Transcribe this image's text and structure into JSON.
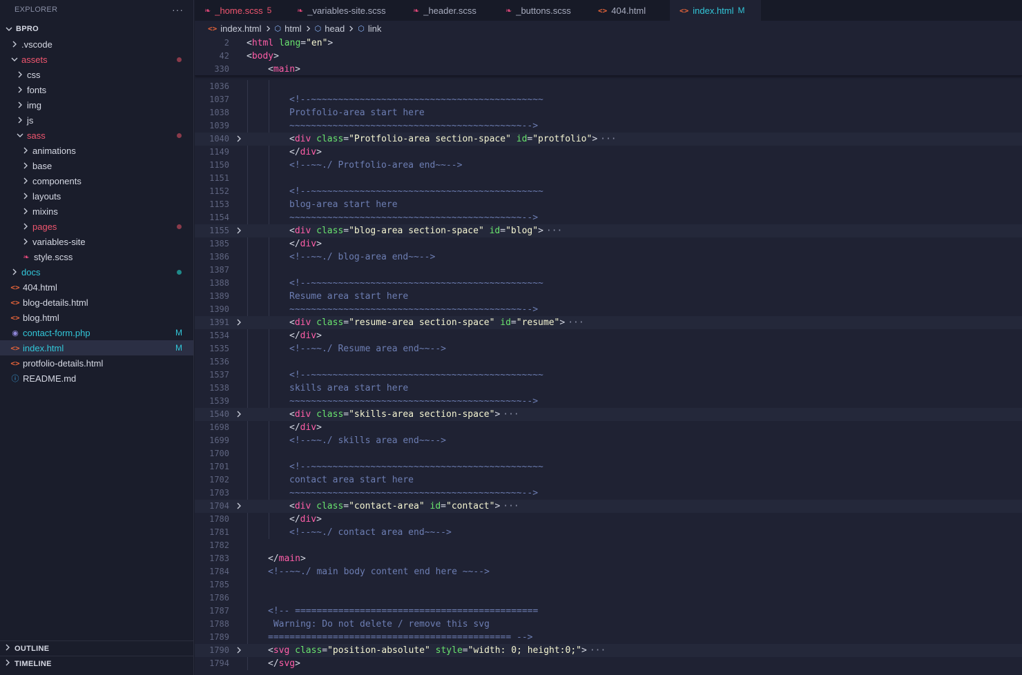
{
  "sidebar": {
    "title": "EXPLORER",
    "menu": "···",
    "tree": [
      {
        "label": "BPRO",
        "kind": "root",
        "chev": "down"
      },
      {
        "label": ".vscode",
        "kind": "folder",
        "chev": "right"
      },
      {
        "label": "assets",
        "kind": "folder",
        "chev": "down",
        "status": "err",
        "dot": "red"
      },
      {
        "label": "css",
        "kind": "folder",
        "chev": "right"
      },
      {
        "label": "fonts",
        "kind": "folder",
        "chev": "right"
      },
      {
        "label": "img",
        "kind": "folder",
        "chev": "right"
      },
      {
        "label": "js",
        "kind": "folder",
        "chev": "right"
      },
      {
        "label": "sass",
        "kind": "folder",
        "chev": "down",
        "status": "err",
        "dot": "red"
      },
      {
        "label": "animations",
        "kind": "folder",
        "chev": "right"
      },
      {
        "label": "base",
        "kind": "folder",
        "chev": "right"
      },
      {
        "label": "components",
        "kind": "folder",
        "chev": "right"
      },
      {
        "label": "layouts",
        "kind": "folder",
        "chev": "right"
      },
      {
        "label": "mixins",
        "kind": "folder",
        "chev": "right"
      },
      {
        "label": "pages",
        "kind": "folder",
        "chev": "right",
        "status": "err",
        "dot": "red"
      },
      {
        "label": "variables-site",
        "kind": "folder",
        "chev": "right"
      },
      {
        "label": "style.scss",
        "kind": "file",
        "icon": "sass-icon"
      },
      {
        "label": "docs",
        "kind": "folder",
        "chev": "right",
        "status": "cyan",
        "dot": "teal"
      },
      {
        "label": "404.html",
        "kind": "file",
        "icon": "html-icon"
      },
      {
        "label": "blog-details.html",
        "kind": "file",
        "icon": "html-icon"
      },
      {
        "label": "blog.html",
        "kind": "file",
        "icon": "html-icon"
      },
      {
        "label": "contact-form.php",
        "kind": "file",
        "icon": "php-icon",
        "status": "cyan",
        "badge": "M"
      },
      {
        "label": "index.html",
        "kind": "file",
        "icon": "html-icon",
        "status": "cyan",
        "badge": "M",
        "active": true
      },
      {
        "label": "protfolio-details.html",
        "kind": "file",
        "icon": "html-icon"
      },
      {
        "label": "README.md",
        "kind": "file",
        "icon": "info-icon"
      }
    ],
    "outline": "OUTLINE",
    "timeline": "TIMELINE"
  },
  "tabs": [
    {
      "label": "_home.scss",
      "icon": "sass-icon",
      "err": true,
      "count": "5"
    },
    {
      "label": "_variables-site.scss",
      "icon": "sass-icon"
    },
    {
      "label": "_header.scss",
      "icon": "sass-icon"
    },
    {
      "label": "_buttons.scss",
      "icon": "sass-icon"
    },
    {
      "label": "404.html",
      "icon": "html-icon"
    },
    {
      "label": "index.html",
      "icon": "html-icon",
      "active": true,
      "modified": "M"
    }
  ],
  "breadcrumb": [
    "index.html",
    "html",
    "head",
    "link"
  ],
  "colors": {
    "tag": "#ff5ea8",
    "attr": "#69e36e",
    "string": "#f5f5d2",
    "comment": "#6d7eb3",
    "accent": "#32c7d9",
    "error": "#f0566f"
  },
  "sticky_lines": [
    {
      "n": "2",
      "tokens": [
        [
          "b",
          "<"
        ],
        [
          "tag",
          "html"
        ],
        [
          "attr",
          " lang"
        ],
        [
          "b",
          "="
        ],
        [
          "str",
          "\"en\""
        ],
        [
          "b",
          ">"
        ]
      ],
      "indent": 0
    },
    {
      "n": "42",
      "tokens": [
        [
          "b",
          "<"
        ],
        [
          "tag",
          "body"
        ],
        [
          "b",
          ">"
        ]
      ],
      "indent": 0
    },
    {
      "n": "330",
      "tokens": [
        [
          "b",
          "<"
        ],
        [
          "tag",
          "main"
        ],
        [
          "b",
          ">"
        ]
      ],
      "indent": 1
    }
  ],
  "lines": [
    {
      "n": "1036",
      "indent": 2,
      "tokens": []
    },
    {
      "n": "1037",
      "indent": 2,
      "tokens": [
        [
          "com",
          "<!--~~~~~~~~~~~~~~~~~~~~~~~~~~~~~~~~~~~~~~~~~~~"
        ]
      ]
    },
    {
      "n": "1038",
      "indent": 2,
      "tokens": [
        [
          "com",
          "Protfolio-area start here"
        ]
      ]
    },
    {
      "n": "1039",
      "indent": 2,
      "tokens": [
        [
          "com",
          "~~~~~~~~~~~~~~~~~~~~~~~~~~~~~~~~~~~~~~~~~~~-->"
        ]
      ]
    },
    {
      "n": "1040",
      "indent": 2,
      "fold": true,
      "tokens": [
        [
          "b",
          "<"
        ],
        [
          "tag",
          "div"
        ],
        [
          "attr",
          " class"
        ],
        [
          "b",
          "="
        ],
        [
          "str",
          "\"Protfolio-area section-space\""
        ],
        [
          "attr",
          " id"
        ],
        [
          "b",
          "="
        ],
        [
          "str",
          "\"protfolio\""
        ],
        [
          "b",
          ">"
        ]
      ]
    },
    {
      "n": "1149",
      "indent": 2,
      "tokens": [
        [
          "b",
          "</"
        ],
        [
          "tag",
          "div"
        ],
        [
          "b",
          ">"
        ]
      ]
    },
    {
      "n": "1150",
      "indent": 2,
      "tokens": [
        [
          "com",
          "<!--~~./ Protfolio-area end~~-->"
        ]
      ]
    },
    {
      "n": "1151",
      "indent": 2,
      "tokens": []
    },
    {
      "n": "1152",
      "indent": 2,
      "tokens": [
        [
          "com",
          "<!--~~~~~~~~~~~~~~~~~~~~~~~~~~~~~~~~~~~~~~~~~~~"
        ]
      ]
    },
    {
      "n": "1153",
      "indent": 2,
      "tokens": [
        [
          "com",
          "blog-area start here"
        ]
      ]
    },
    {
      "n": "1154",
      "indent": 2,
      "tokens": [
        [
          "com",
          "~~~~~~~~~~~~~~~~~~~~~~~~~~~~~~~~~~~~~~~~~~~-->"
        ]
      ]
    },
    {
      "n": "1155",
      "indent": 2,
      "fold": true,
      "tokens": [
        [
          "b",
          "<"
        ],
        [
          "tag",
          "div"
        ],
        [
          "attr",
          " class"
        ],
        [
          "b",
          "="
        ],
        [
          "str",
          "\"blog-area section-space\""
        ],
        [
          "attr",
          " id"
        ],
        [
          "b",
          "="
        ],
        [
          "str",
          "\"blog\""
        ],
        [
          "b",
          ">"
        ]
      ]
    },
    {
      "n": "1385",
      "indent": 2,
      "tokens": [
        [
          "b",
          "</"
        ],
        [
          "tag",
          "div"
        ],
        [
          "b",
          ">"
        ]
      ]
    },
    {
      "n": "1386",
      "indent": 2,
      "tokens": [
        [
          "com",
          "<!--~~./ blog-area end~~-->"
        ]
      ]
    },
    {
      "n": "1387",
      "indent": 2,
      "tokens": []
    },
    {
      "n": "1388",
      "indent": 2,
      "tokens": [
        [
          "com",
          "<!--~~~~~~~~~~~~~~~~~~~~~~~~~~~~~~~~~~~~~~~~~~~"
        ]
      ]
    },
    {
      "n": "1389",
      "indent": 2,
      "tokens": [
        [
          "com",
          "Resume area start here"
        ]
      ]
    },
    {
      "n": "1390",
      "indent": 2,
      "tokens": [
        [
          "com",
          "~~~~~~~~~~~~~~~~~~~~~~~~~~~~~~~~~~~~~~~~~~~-->"
        ]
      ]
    },
    {
      "n": "1391",
      "indent": 2,
      "fold": true,
      "tokens": [
        [
          "b",
          "<"
        ],
        [
          "tag",
          "div"
        ],
        [
          "attr",
          " class"
        ],
        [
          "b",
          "="
        ],
        [
          "str",
          "\"resume-area section-space\""
        ],
        [
          "attr",
          " id"
        ],
        [
          "b",
          "="
        ],
        [
          "str",
          "\"resume\""
        ],
        [
          "b",
          ">"
        ]
      ]
    },
    {
      "n": "1534",
      "indent": 2,
      "tokens": [
        [
          "b",
          "</"
        ],
        [
          "tag",
          "div"
        ],
        [
          "b",
          ">"
        ]
      ]
    },
    {
      "n": "1535",
      "indent": 2,
      "tokens": [
        [
          "com",
          "<!--~~./ Resume area end~~-->"
        ]
      ]
    },
    {
      "n": "1536",
      "indent": 2,
      "tokens": []
    },
    {
      "n": "1537",
      "indent": 2,
      "tokens": [
        [
          "com",
          "<!--~~~~~~~~~~~~~~~~~~~~~~~~~~~~~~~~~~~~~~~~~~~"
        ]
      ]
    },
    {
      "n": "1538",
      "indent": 2,
      "tokens": [
        [
          "com",
          "skills area start here"
        ]
      ]
    },
    {
      "n": "1539",
      "indent": 2,
      "tokens": [
        [
          "com",
          "~~~~~~~~~~~~~~~~~~~~~~~~~~~~~~~~~~~~~~~~~~~-->"
        ]
      ]
    },
    {
      "n": "1540",
      "indent": 2,
      "fold": true,
      "tokens": [
        [
          "b",
          "<"
        ],
        [
          "tag",
          "div"
        ],
        [
          "attr",
          " class"
        ],
        [
          "b",
          "="
        ],
        [
          "str",
          "\"skills-area section-space\""
        ],
        [
          "b",
          ">"
        ]
      ]
    },
    {
      "n": "1698",
      "indent": 2,
      "tokens": [
        [
          "b",
          "</"
        ],
        [
          "tag",
          "div"
        ],
        [
          "b",
          ">"
        ]
      ]
    },
    {
      "n": "1699",
      "indent": 2,
      "tokens": [
        [
          "com",
          "<!--~~./ skills area end~~-->"
        ]
      ]
    },
    {
      "n": "1700",
      "indent": 2,
      "tokens": []
    },
    {
      "n": "1701",
      "indent": 2,
      "tokens": [
        [
          "com",
          "<!--~~~~~~~~~~~~~~~~~~~~~~~~~~~~~~~~~~~~~~~~~~~"
        ]
      ]
    },
    {
      "n": "1702",
      "indent": 2,
      "tokens": [
        [
          "com",
          "contact area start here"
        ]
      ]
    },
    {
      "n": "1703",
      "indent": 2,
      "tokens": [
        [
          "com",
          "~~~~~~~~~~~~~~~~~~~~~~~~~~~~~~~~~~~~~~~~~~~-->"
        ]
      ]
    },
    {
      "n": "1704",
      "indent": 2,
      "fold": true,
      "tokens": [
        [
          "b",
          "<"
        ],
        [
          "tag",
          "div"
        ],
        [
          "attr",
          " class"
        ],
        [
          "b",
          "="
        ],
        [
          "str",
          "\"contact-area\""
        ],
        [
          "attr",
          " id"
        ],
        [
          "b",
          "="
        ],
        [
          "str",
          "\"contact\""
        ],
        [
          "b",
          ">"
        ]
      ]
    },
    {
      "n": "1780",
      "indent": 2,
      "tokens": [
        [
          "b",
          "</"
        ],
        [
          "tag",
          "div"
        ],
        [
          "b",
          ">"
        ]
      ]
    },
    {
      "n": "1781",
      "indent": 2,
      "tokens": [
        [
          "com",
          "<!--~~./ contact area end~~-->"
        ]
      ]
    },
    {
      "n": "1782",
      "indent": 2,
      "tokens": []
    },
    {
      "n": "1783",
      "indent": 1,
      "tokens": [
        [
          "b",
          "</"
        ],
        [
          "tag",
          "main"
        ],
        [
          "b",
          ">"
        ]
      ]
    },
    {
      "n": "1784",
      "indent": 1,
      "tokens": [
        [
          "com",
          "<!--~~./ main body content end here ~~-->"
        ]
      ]
    },
    {
      "n": "1785",
      "indent": 1,
      "tokens": []
    },
    {
      "n": "1786",
      "indent": 1,
      "tokens": []
    },
    {
      "n": "1787",
      "indent": 1,
      "tokens": [
        [
          "com",
          "<!-- ============================================="
        ]
      ]
    },
    {
      "n": "1788",
      "indent": 1,
      "tokens": [
        [
          "com",
          " Warning: Do not delete / remove this svg"
        ]
      ]
    },
    {
      "n": "1789",
      "indent": 1,
      "tokens": [
        [
          "com",
          "============================================= -->"
        ]
      ]
    },
    {
      "n": "1790",
      "indent": 1,
      "fold": true,
      "tokens": [
        [
          "b",
          "<"
        ],
        [
          "tag",
          "svg"
        ],
        [
          "attr",
          " class"
        ],
        [
          "b",
          "="
        ],
        [
          "str",
          "\"position-absolute\""
        ],
        [
          "attr",
          " style"
        ],
        [
          "b",
          "="
        ],
        [
          "str",
          "\"width: 0; height:0;\""
        ],
        [
          "b",
          ">"
        ]
      ]
    },
    {
      "n": "1794",
      "indent": 1,
      "tokens": [
        [
          "b",
          "</"
        ],
        [
          "tag",
          "svg"
        ],
        [
          "b",
          ">"
        ]
      ]
    }
  ],
  "fold_ellipsis": "···"
}
